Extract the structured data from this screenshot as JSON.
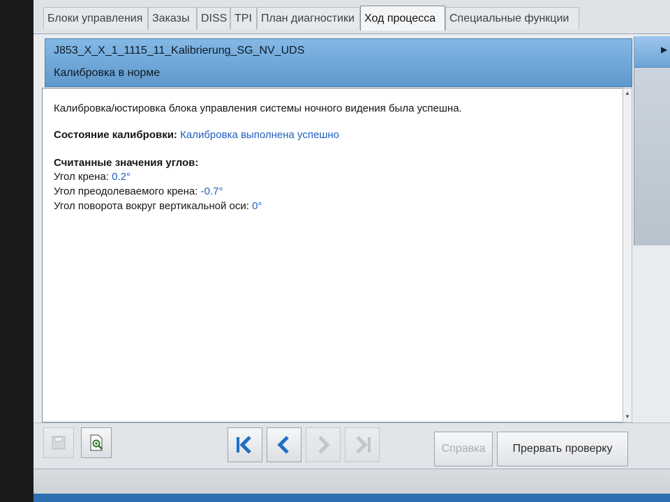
{
  "tabs": [
    {
      "label": "Блоки управления",
      "active": false
    },
    {
      "label": "Заказы",
      "active": false
    },
    {
      "label": "DISS",
      "active": false
    },
    {
      "label": "TPI",
      "active": false
    },
    {
      "label": "План диагностики",
      "active": false
    },
    {
      "label": "Ход процесса",
      "active": true
    },
    {
      "label": "Специальные функции",
      "active": false
    }
  ],
  "header": {
    "title": "J853_X_X_1_1115_11_Kalibrierung_SG_NV_UDS",
    "subtitle": "Калибровка в норме"
  },
  "content": {
    "intro": "Калибровка/юстировка блока управления системы ночного видения была успешна.",
    "status_label": "Состояние калибровки:",
    "status_value": "Калибровка выполнена успешно",
    "angles_heading": "Считанные значения углов:",
    "angles": [
      {
        "label": "Угол крена:",
        "value": "0.2°"
      },
      {
        "label": "Угол преодолеваемого крена:",
        "value": "-0.7°"
      },
      {
        "label": "Угол поворота вокруг вертикальной оси:",
        "value": "0°"
      }
    ]
  },
  "toolbar": {
    "help_label": "Справка",
    "abort_label": "Прервать проверку"
  },
  "colors": {
    "accent_blue": "#1f5fbf",
    "header_blue": "#6fa7d9"
  },
  "icons": [
    "save-icon",
    "zoom-document-icon",
    "first-step-icon",
    "previous-step-icon",
    "next-step-icon",
    "last-step-icon",
    "side-arrow-icon"
  ]
}
